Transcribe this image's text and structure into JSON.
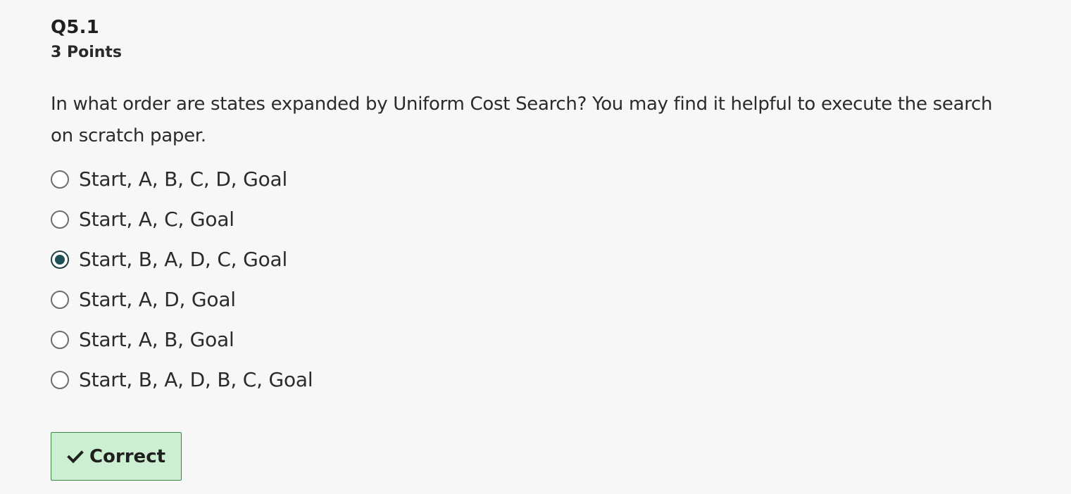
{
  "question": {
    "number": "Q5.1",
    "points": "3 Points",
    "prompt": "In what order are states expanded by Uniform Cost Search?  You may find it helpful to execute the search on scratch paper.",
    "options": [
      {
        "label": "Start, A, B, C, D, Goal",
        "selected": false
      },
      {
        "label": "Start, A, C, Goal",
        "selected": false
      },
      {
        "label": "Start, B, A, D, C, Goal",
        "selected": true
      },
      {
        "label": "Start, A, D, Goal",
        "selected": false
      },
      {
        "label": "Start, A, B, Goal",
        "selected": false
      },
      {
        "label": "Start, B, A, D, B, C, Goal",
        "selected": false
      }
    ]
  },
  "result": {
    "label": "Correct",
    "icon": "check-icon",
    "background_color": "#ccefd2",
    "border_color": "#3a8a45"
  },
  "colors": {
    "radio_selected": "#1e4f56",
    "page_background": "#f7f7f7"
  }
}
